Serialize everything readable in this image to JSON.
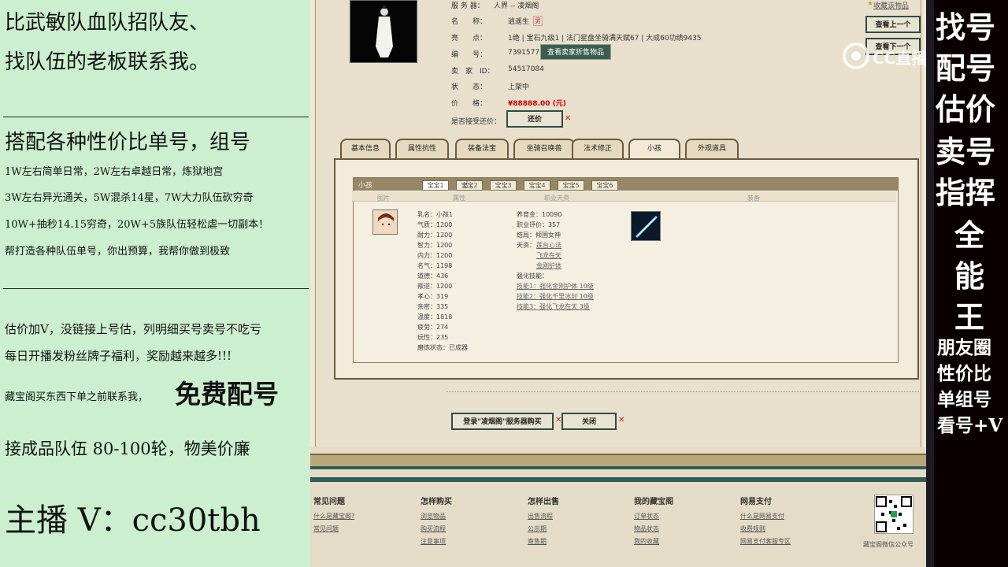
{
  "left_panel": {
    "line1": "比武敏队血队招队友、",
    "line2": "找队伍的老板联系我。",
    "line3": "搭配各种性价比单号，组号",
    "line4": "1W左右简单日常，2W左右卓越日常，炼狱地宫",
    "line5": "3W左右异光通关，5W混杀14星，7W大力队伍砍穷奇",
    "line6": "10W+抽秒14.15穷奇，20W+5族队伍轻松虐一切副本！",
    "line7": "帮打造各种队伍单号，你出预算，我帮你做到极致",
    "line8": "估价加V，没链接上号估，列明细买号卖号不吃亏",
    "line9": "每日开播发粉丝牌子福利，奖励越来越多!!!",
    "line10a": "藏宝阁买东西下单之前联系我，",
    "line10b": "免费配号",
    "line11": "接成品队伍 80-100轮，物美价廉",
    "line12": "主播 V：cc30tbh"
  },
  "right_panel": {
    "r1": "找号",
    "r2": "配号",
    "r3": "估价",
    "r4": "卖号",
    "r5": "指挥",
    "r6": "全",
    "r7": "能",
    "r8": "王",
    "r9": "朋友圈",
    "r10": "性价比",
    "r11": "单组号",
    "r12": "看号+V",
    "watermark": "CC直播"
  },
  "top_right": {
    "favorite": "收藏该物品",
    "prev": "查看上一个",
    "next": "查看下一个"
  },
  "item_info": {
    "server_label": "服 务 器：",
    "server_value": "人界 -- 凌烟阁",
    "name_label": "名　　称：",
    "name_value": "逍遥生",
    "name_tag": "男",
    "highlight_label": "亮　　点：",
    "highlight_value": "1绝 | 宝石九级1 | 法门星盘坐骑满天赋67 | 大成60功绩9435",
    "code_label": "编　　号：",
    "code_value": "7391577",
    "seller_button": "查看卖家折售物品",
    "seller_label": "卖　家　ID：",
    "seller_value": "54517084",
    "status_label": "状　　态：",
    "status_value": "上架中",
    "price_label": "价　　格：",
    "price_value": "¥88888.00 (元)",
    "bargain_label": "是否接受还价：",
    "bargain_button": "还价"
  },
  "tabs": [
    "基本信息",
    "属性抗性",
    "装备法宝",
    "坐骑召唤兽",
    "法术修正",
    "小孩",
    "外观道具"
  ],
  "child_panel": {
    "title": "小孩",
    "subtabs": [
      "宝宝1",
      "宝宝2",
      "宝宝3",
      "宝宝4",
      "宝宝5",
      "宝宝6"
    ],
    "headers": [
      "图片",
      "属性",
      "职业天资",
      "装备"
    ],
    "attrs": [
      "乳名：小孩1",
      "气质：1200",
      "耐力：1200",
      "智力：1200",
      "内力：1200",
      "名气：1198",
      "道德：436",
      "叛逆：1200",
      "孝心：319",
      "亲密：335",
      "温度：1818",
      "疲劳：274",
      "玩性：235",
      "磨炼状态：已成器"
    ],
    "talent": {
      "gold": "养育金：10090",
      "rating": "职业评价：357",
      "ending": "结局：倾国女神",
      "gift_label": "天资：",
      "gifts": [
        "莲台心法",
        "飞龙在天",
        "金刚护体"
      ],
      "skill_label": "强化技能：",
      "skills": [
        "技能1：强化金刚护体 10级",
        "技能2：强化千里冰封 10级",
        "技能3：强化飞龙在天 3级"
      ]
    }
  },
  "bottom_buttons": {
    "login": "登录\"凌烟阁\"服务器购买",
    "close": "关闭"
  },
  "footer": {
    "col1_title": "常见问题",
    "col1_links": [
      "什么是藏宝阁?",
      "常见问题"
    ],
    "col2_title": "怎样购买",
    "col2_links": [
      "浏览物品",
      "购买流程",
      "注意事项"
    ],
    "col3_title": "怎样出售",
    "col3_links": [
      "出售流程",
      "公示期",
      "寄售期"
    ],
    "col4_title": "我的藏宝阁",
    "col4_links": [
      "订单状态",
      "物品状态",
      "我的收藏"
    ],
    "col5_title": "网易支付",
    "col5_links": [
      "什么是网易支付",
      "收费规则",
      "网易支付客服专区"
    ],
    "qr_caption": "藏宝阁微信公众号"
  },
  "colors": {
    "left_bg": "#ccf0cf",
    "right_bg": "#0a0000",
    "page_bg": "#e8e0cc",
    "button_green": "#3d5d52",
    "price_red": "#cc0000"
  }
}
